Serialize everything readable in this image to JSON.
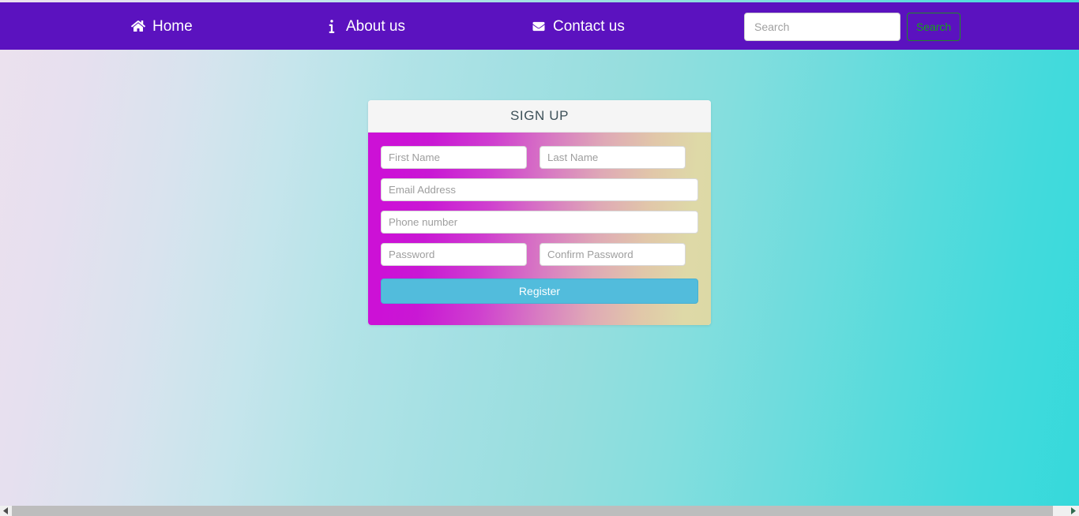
{
  "navbar": {
    "background_color": "#5b12bf",
    "links": [
      {
        "label": "Home",
        "icon": "home-icon"
      },
      {
        "label": "About us",
        "icon": "info-icon"
      },
      {
        "label": "Contact us",
        "icon": "envelope-icon"
      }
    ],
    "search": {
      "placeholder": "Search",
      "value": "",
      "button_label": "Search",
      "button_text_color": "#13a418",
      "button_border_color": "#1f8b24"
    }
  },
  "signup_card": {
    "title": "SIGN UP",
    "header_background": "#f5f5f5",
    "title_color": "#3d5058",
    "body_gradient_from": "#cc11d6",
    "body_gradient_to": "#dcd9a6",
    "fields": {
      "first_name": {
        "placeholder": "First Name",
        "value": "",
        "type": "text"
      },
      "last_name": {
        "placeholder": "Last Name",
        "value": "",
        "type": "text"
      },
      "email": {
        "placeholder": "Email Address",
        "value": "",
        "type": "text"
      },
      "phone": {
        "placeholder": "Phone number",
        "value": "",
        "type": "text"
      },
      "password": {
        "placeholder": "Password",
        "value": "",
        "type": "password"
      },
      "confirm_password": {
        "placeholder": "Confirm Password",
        "value": "",
        "type": "password"
      }
    },
    "submit_label": "Register",
    "submit_color": "#52bcdc"
  },
  "background": {
    "gradient_from": "#ece1ee",
    "gradient_mid": "#96dede",
    "gradient_to": "#35d9db"
  },
  "scrollbar": {
    "orientation": "horizontal",
    "thumb_color": "#bdbdbd",
    "track_color": "#f0f0f0"
  }
}
